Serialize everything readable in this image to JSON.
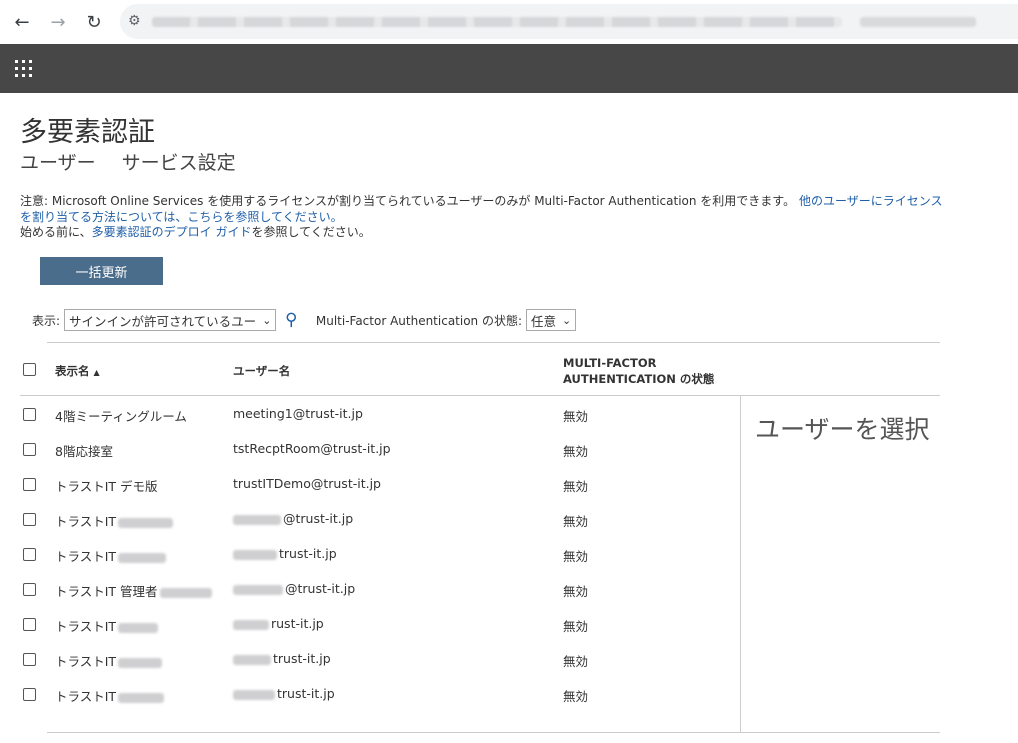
{
  "browser": {
    "back_icon": "←",
    "forward_icon": "→",
    "reload_icon": "↻",
    "site_info_icon": "⚙"
  },
  "page": {
    "title": "多要素認証",
    "tabs": [
      "ユーザー",
      "サービス設定"
    ]
  },
  "notice": {
    "line1_prefix": "注意: Microsoft Online Services を使用するライセンスが割り当てられているユーザーのみが Multi-Factor Authentication を利用できます。 ",
    "line1_link": "他のユーザーにライセンスを割り当てる方法については、こちらを参照してください。",
    "line2_prefix": "始める前に、",
    "line2_link": "多要素認証のデプロイ ガイド",
    "line2_suffix": "を参照してください。"
  },
  "toolbar": {
    "bulk_update_label": "一括更新",
    "view_label": "表示:",
    "view_selected": "サインインが許可されているユー",
    "mfa_state_label": "Multi-Factor Authentication の状態:",
    "mfa_state_selected": "任意"
  },
  "table": {
    "columns": {
      "display_name": "表示名",
      "user_name": "ユーザー名",
      "mfa_line1": "MULTI-FACTOR",
      "mfa_line2": "AUTHENTICATION の状態"
    },
    "rows": [
      {
        "display": "4階ミーティングルーム",
        "user": "meeting1@trust-it.jp",
        "status": "無効"
      },
      {
        "display": "8階応接室",
        "user": "tstRecptRoom@trust-it.jp",
        "status": "無効"
      },
      {
        "display": "トラストIT デモ版",
        "user": "trustITDemo@trust-it.jp",
        "status": "無効"
      },
      {
        "display": "トラストIT",
        "user": "@trust-it.jp",
        "status": "無効"
      },
      {
        "display": "トラストIT",
        "user": "trust-it.jp",
        "status": "無効"
      },
      {
        "display": "トラストIT 管理者",
        "user": "@trust-it.jp",
        "status": "無効"
      },
      {
        "display": "トラストIT",
        "user": "rust-it.jp",
        "status": "無効"
      },
      {
        "display": "トラストIT",
        "user": "trust-it.jp",
        "status": "無効"
      },
      {
        "display": "トラストIT",
        "user": "trust-it.jp",
        "status": "無効"
      }
    ]
  },
  "detail_panel": {
    "placeholder": "ユーザーを選択"
  }
}
